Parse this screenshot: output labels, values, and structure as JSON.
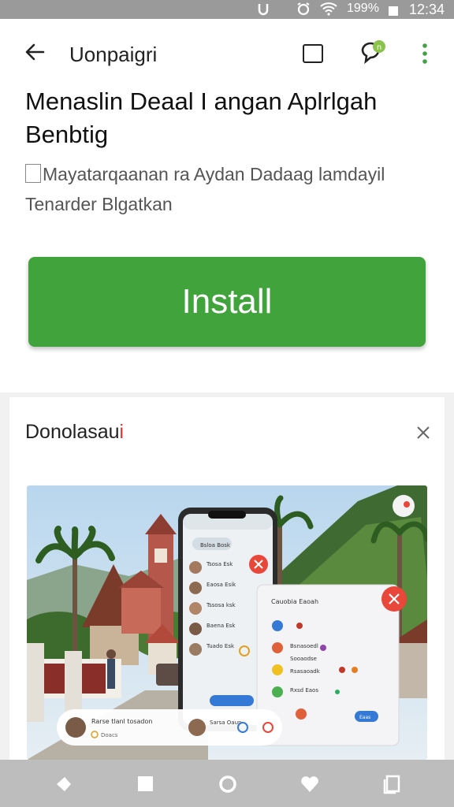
{
  "status_bar": {
    "battery": "199%",
    "time": "12:34"
  },
  "app_bar": {
    "title": "Uonpaigri"
  },
  "headline": "Menaslin Deaal I angan Aplrlgah Benbtig",
  "subtitle_line1": "Mayatarqaanan ra Aydan Dadaag lamdayil",
  "subtitle_line2": "Tenarder Blgatkan",
  "install_label": "Install",
  "card2": {
    "title": "Donolasau",
    "title_mark": "i"
  },
  "promo": {
    "phone_rows": [
      "Tsosa Esk",
      "Eaosa Esik",
      "Tssosa ksk",
      "Baena Esk",
      "Tuado Esk"
    ],
    "tab_label": "Bsloa Bosk",
    "panel_title": "Cauobia Eaoah",
    "panel_rows": [
      "Bsnasoedl",
      "Sooaodse",
      "Rsasaoadk",
      "Rxsd Eaos"
    ],
    "panel_button": "Eaas",
    "bubble_title": "Rarse tlanl tosadon",
    "bubble_sub": "Doacs",
    "bubble_right": "Sarsa Oaun"
  },
  "colors": {
    "primary": "#40a33c",
    "accent_red": "#e8473a"
  }
}
